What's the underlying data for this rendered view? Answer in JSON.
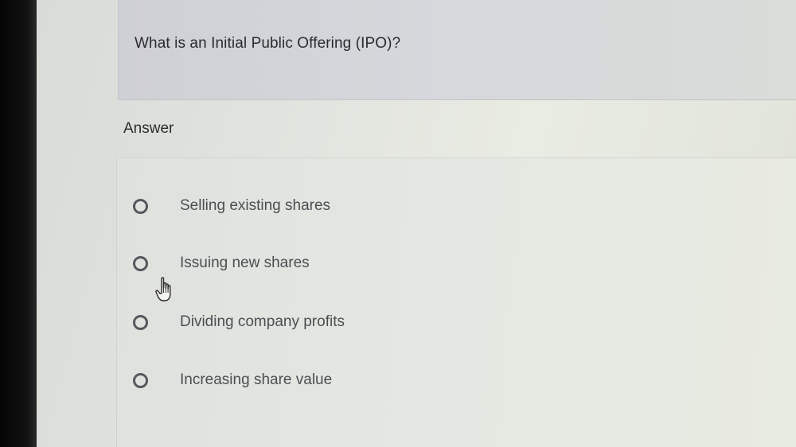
{
  "question": {
    "text": "What is an Initial Public Offering (IPO)?"
  },
  "answer_heading": "Answer",
  "options": [
    {
      "label": "Selling existing shares",
      "selected": false
    },
    {
      "label": "Issuing new shares",
      "selected": false
    },
    {
      "label": "Dividing company profits",
      "selected": false
    },
    {
      "label": "Increasing share value",
      "selected": false
    }
  ],
  "icons": {
    "cursor": "hand-pointer-icon",
    "radio": "radio-unchecked-icon"
  },
  "colors": {
    "text_primary": "#2a2b2e",
    "text_option": "#4c4e52",
    "radio_border": "#55585c"
  }
}
